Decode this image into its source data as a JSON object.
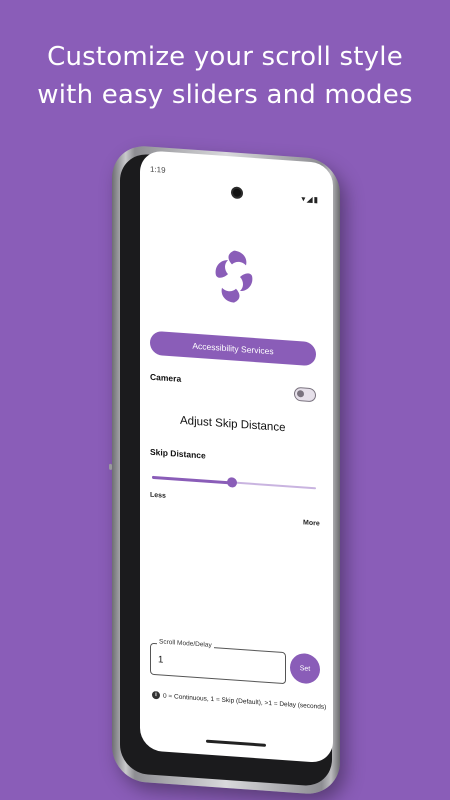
{
  "headline": {
    "line1": "Customize your scroll style",
    "line2": "with easy sliders and modes"
  },
  "status_bar": {
    "time": "1:19",
    "icons": "▾◢▮"
  },
  "app": {
    "accessibility_button": "Accessibility Services",
    "camera_label": "Camera",
    "camera_toggle_on": false,
    "adjust_title": "Adjust Skip Distance",
    "skip_distance_label": "Skip Distance",
    "slider_value_fraction": 0.49,
    "slider_min_label": "Less",
    "slider_max_label": "More",
    "scroll_mode_label": "Scroll Mode/Delay",
    "scroll_mode_value": "1",
    "set_button": "Set",
    "hint_text": "0 = Continuous, 1 = Skip (Default), >1 = Delay (seconds)",
    "accent_color": "#8a5db8"
  }
}
